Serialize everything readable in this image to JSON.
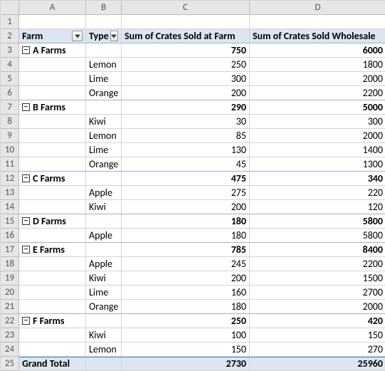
{
  "columns": [
    "A",
    "B",
    "C",
    "D"
  ],
  "row_numbers": [
    "1",
    "2",
    "3",
    "4",
    "5",
    "6",
    "7",
    "8",
    "9",
    "10",
    "11",
    "12",
    "13",
    "14",
    "15",
    "16",
    "17",
    "18",
    "19",
    "20",
    "21",
    "22",
    "23",
    "24",
    "25"
  ],
  "headers": {
    "farm": "Farm",
    "type": "Type",
    "sum_farm": "Sum of Crates Sold at Farm",
    "sum_wholesale": "Sum of Crates Sold Wholesale"
  },
  "grand_total_label": "Grand Total",
  "grand_total": {
    "farm": "2730",
    "wholesale": "25960"
  },
  "groups": [
    {
      "name": "A Farms",
      "sum_farm": "750",
      "sum_wholesale": "6000",
      "rows": [
        {
          "type": "Lemon",
          "farm": "250",
          "wholesale": "1800"
        },
        {
          "type": "Lime",
          "farm": "300",
          "wholesale": "2000"
        },
        {
          "type": "Orange",
          "farm": "200",
          "wholesale": "2200"
        }
      ]
    },
    {
      "name": "B Farms",
      "sum_farm": "290",
      "sum_wholesale": "5000",
      "rows": [
        {
          "type": "Kiwi",
          "farm": "30",
          "wholesale": "300"
        },
        {
          "type": "Lemon",
          "farm": "85",
          "wholesale": "2000"
        },
        {
          "type": "Lime",
          "farm": "130",
          "wholesale": "1400"
        },
        {
          "type": "Orange",
          "farm": "45",
          "wholesale": "1300"
        }
      ]
    },
    {
      "name": "C Farms",
      "sum_farm": "475",
      "sum_wholesale": "340",
      "rows": [
        {
          "type": "Apple",
          "farm": "275",
          "wholesale": "220"
        },
        {
          "type": "Kiwi",
          "farm": "200",
          "wholesale": "120"
        }
      ]
    },
    {
      "name": "D Farms",
      "sum_farm": "180",
      "sum_wholesale": "5800",
      "rows": [
        {
          "type": "Apple",
          "farm": "180",
          "wholesale": "5800"
        }
      ]
    },
    {
      "name": "E Farms",
      "sum_farm": "785",
      "sum_wholesale": "8400",
      "rows": [
        {
          "type": "Apple",
          "farm": "245",
          "wholesale": "2200"
        },
        {
          "type": "Kiwi",
          "farm": "200",
          "wholesale": "1500"
        },
        {
          "type": "Lime",
          "farm": "160",
          "wholesale": "2700"
        },
        {
          "type": "Orange",
          "farm": "180",
          "wholesale": "2000"
        }
      ]
    },
    {
      "name": "F Farms",
      "sum_farm": "250",
      "sum_wholesale": "420",
      "rows": [
        {
          "type": "Kiwi",
          "farm": "100",
          "wholesale": "150"
        },
        {
          "type": "Lemon",
          "farm": "150",
          "wholesale": "270"
        }
      ]
    }
  ]
}
